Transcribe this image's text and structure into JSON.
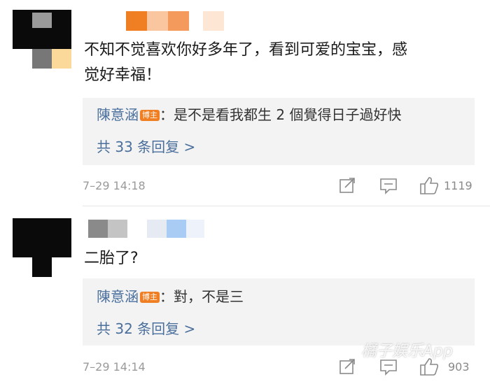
{
  "comments": [
    {
      "text_line1": "不知不觉喜欢你好多年了，看到可爱的宝宝，感",
      "text_line2": "觉好幸福！",
      "reply": {
        "author": "陳意涵",
        "badge": "博主",
        "text": "：是不是看我都生 2 個覺得日子過好快"
      },
      "more_replies": "共 33 条回复 >",
      "time": "7–29 14:18",
      "likes": "1119"
    },
    {
      "text": "二胎了?",
      "reply": {
        "author": "陳意涵",
        "badge": "博主",
        "text": "：對，不是三"
      },
      "more_replies": "共 32 条回复 >",
      "time": "7–29 14:14",
      "likes": "903"
    }
  ],
  "watermark": "橘子娱乐App",
  "icons": [
    "share-icon",
    "comment-icon",
    "thumbs-up-icon"
  ],
  "colors": {
    "link": "#4a6f9c",
    "badge": "#f07f24",
    "reply_bg": "#f3f3f3"
  }
}
